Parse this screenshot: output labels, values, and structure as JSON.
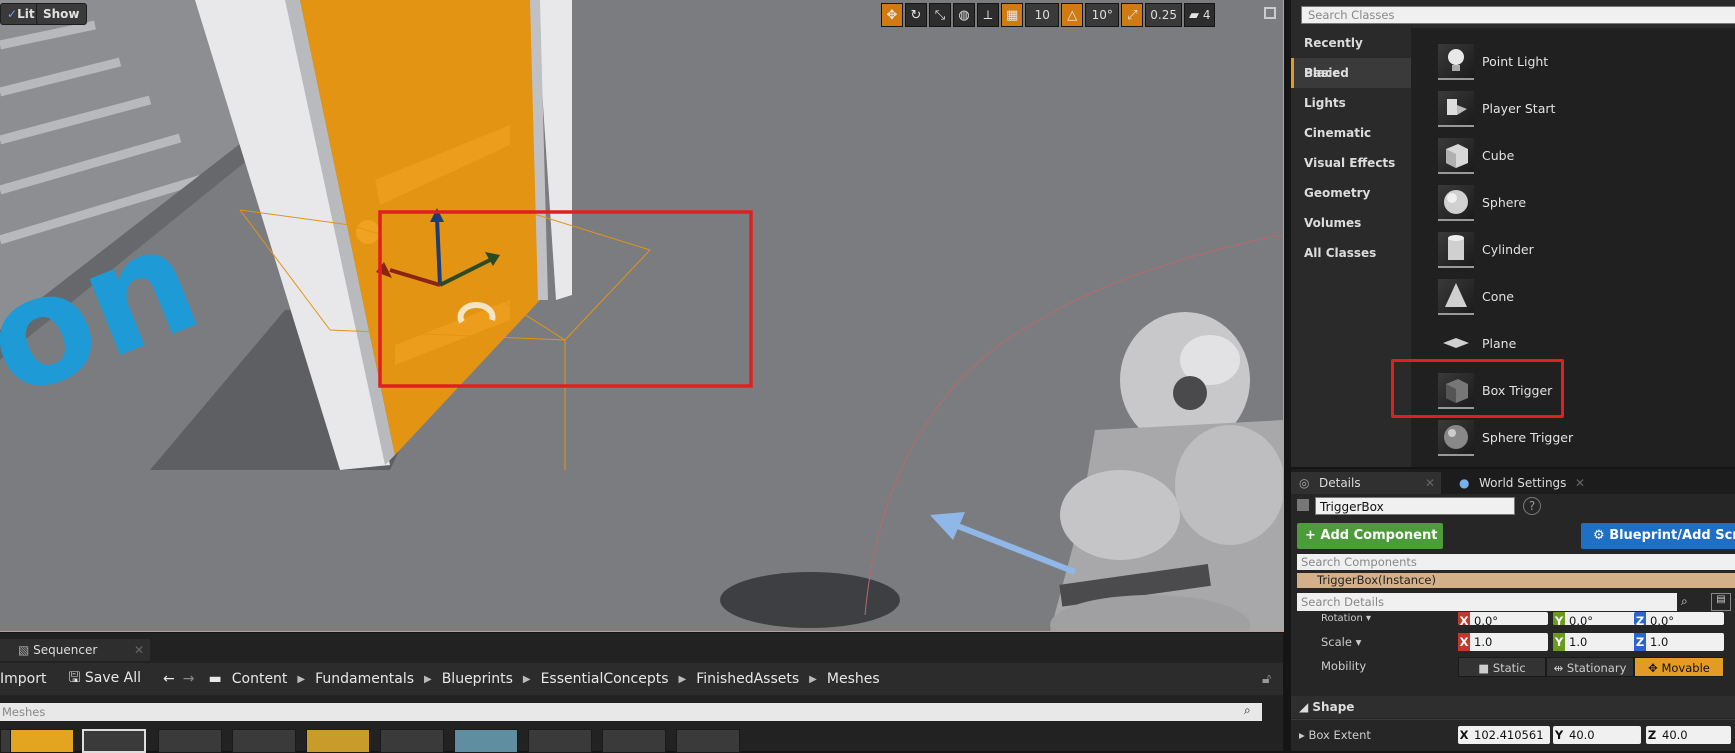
{
  "viewport": {
    "lit_label": "Lit",
    "show_label": "Show",
    "grid_snap": "10",
    "rotation_snap": "10°",
    "scale_snap": "0.25",
    "camera_speed": "4"
  },
  "place_actors": {
    "search_placeholder": "Search Classes",
    "categories": [
      {
        "label": "Recently Placed"
      },
      {
        "label": "Basic"
      },
      {
        "label": "Lights"
      },
      {
        "label": "Cinematic"
      },
      {
        "label": "Visual Effects"
      },
      {
        "label": "Geometry"
      },
      {
        "label": "Volumes"
      },
      {
        "label": "All Classes"
      }
    ],
    "selected_category": "Basic",
    "classes": [
      {
        "label": "Point Light",
        "icon": "lightbulb-icon"
      },
      {
        "label": "Player Start",
        "icon": "player-start-icon"
      },
      {
        "label": "Cube",
        "icon": "cube-icon"
      },
      {
        "label": "Sphere",
        "icon": "sphere-icon"
      },
      {
        "label": "Cylinder",
        "icon": "cylinder-icon"
      },
      {
        "label": "Cone",
        "icon": "cone-icon"
      },
      {
        "label": "Plane",
        "icon": "plane-icon"
      },
      {
        "label": "Box Trigger",
        "icon": "box-trigger-icon"
      },
      {
        "label": "Sphere Trigger",
        "icon": "sphere-trigger-icon"
      }
    ],
    "highlighted_class": "Box Trigger"
  },
  "details": {
    "tab_details": "Details",
    "tab_world_settings": "World Settings",
    "actor_name": "TriggerBox",
    "add_component_label": "+ Add Component ▾",
    "blueprint_label": "Blueprint/Add Script",
    "search_components_placeholder": "Search Components",
    "instance_label": "TriggerBox(Instance)",
    "search_details_placeholder": "Search Details",
    "rotation_label": "Rotation ▾",
    "rotation": {
      "x": "0.0°",
      "y": "0.0°",
      "z": "0.0°"
    },
    "scale_label": "Scale ▾",
    "scale": {
      "x": "1.0",
      "y": "1.0",
      "z": "1.0"
    },
    "mobility_label": "Mobility",
    "mobility_options": [
      "Static",
      "Stationary",
      "Movable"
    ],
    "mobility_selected": "Movable",
    "shape_section": "Shape",
    "box_extent_label": "Box Extent",
    "box_extent": {
      "x": "102.410561",
      "y": "40.0",
      "z": "40.0"
    }
  },
  "bottom": {
    "sequencer_tab": "Sequencer",
    "import_label": "Import",
    "save_all_label": "Save All",
    "breadcrumb": [
      "Content",
      "Fundamentals",
      "Blueprints",
      "EssentialConcepts",
      "FinishedAssets",
      "Meshes"
    ],
    "search_placeholder": "Meshes"
  },
  "scene_text": "on",
  "colors": {
    "accent": "#e19a25",
    "highlight_red": "#e02020",
    "door_orange": "#e39412"
  }
}
